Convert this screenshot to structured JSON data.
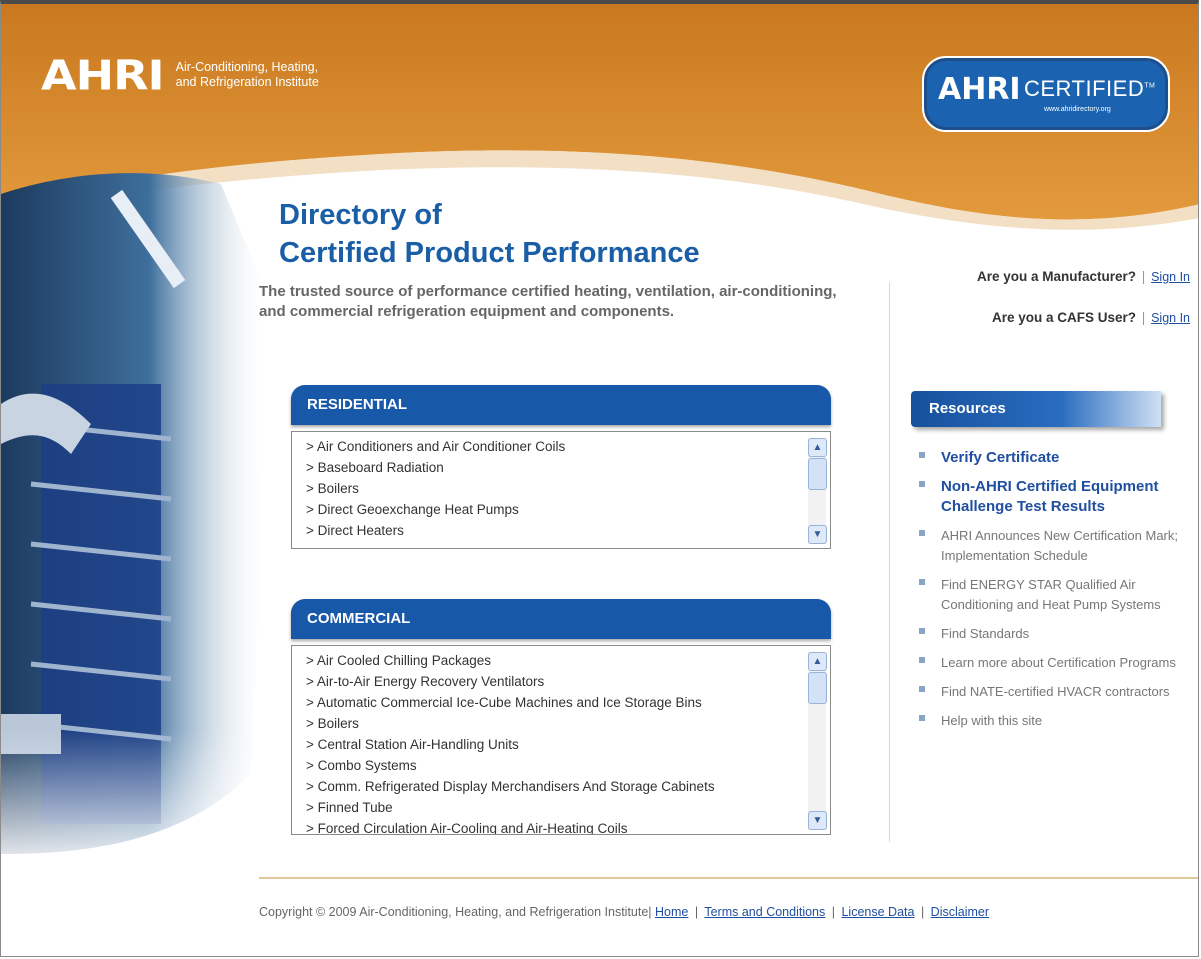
{
  "header": {
    "logo_mark": "AHRI",
    "logo_line1": "Air-Conditioning, Heating,",
    "logo_line2": "and Refrigeration Institute",
    "badge_mark": "AHRI",
    "badge_word": "CERTIFIED",
    "badge_tm": "TM",
    "badge_url": "www.ahridirectory.org",
    "colors": {
      "orange": "#d9862a",
      "blue": "#1858a8"
    }
  },
  "main": {
    "title_line1": "Directory of",
    "title_line2": "Certified Product Performance",
    "tagline": "The trusted source of performance certified heating, ventilation, air-conditioning, and commercial refrigeration equipment and components."
  },
  "residential": {
    "heading": "RESIDENTIAL",
    "items": [
      "> Air Conditioners and Air Conditioner Coils",
      "> Baseboard Radiation",
      "> Boilers",
      "> Direct Geoexchange Heat Pumps",
      "> Direct Heaters"
    ]
  },
  "commercial": {
    "heading": "COMMERCIAL",
    "items": [
      "> Air Cooled Chilling Packages",
      "> Air-to-Air Energy Recovery Ventilators",
      "> Automatic Commercial Ice-Cube Machines and Ice Storage Bins",
      "> Boilers",
      "> Central Station Air-Handling Units",
      "> Combo Systems",
      "> Comm. Refrigerated Display Merchandisers And Storage Cabinets",
      "> Finned Tube",
      "> Forced Circulation Air-Cooling and Air-Heating Coils"
    ]
  },
  "signin": {
    "manufacturer_q": "Are you a Manufacturer?",
    "cafs_q": "Are you a CAFS User?",
    "sep": "|",
    "link": "Sign In"
  },
  "resources": {
    "heading": "Resources",
    "items": [
      "Verify Certificate",
      "Non-AHRI Certified Equipment Challenge Test Results",
      "AHRI Announces New Certification Mark; Implementation Schedule",
      "Find ENERGY STAR Qualified Air Conditioning and Heat Pump Systems",
      "Find Standards",
      "Learn more about Certification Programs",
      "Find NATE-certified HVACR contractors",
      "Help with this site"
    ]
  },
  "footer": {
    "copyright": "Copyright © 2009 Air-Conditioning, Heating, and Refrigeration Institute|",
    "sep": "|",
    "home": "Home",
    "terms": "Terms and Conditions",
    "license": "License Data",
    "disclaimer": "Disclaimer"
  }
}
